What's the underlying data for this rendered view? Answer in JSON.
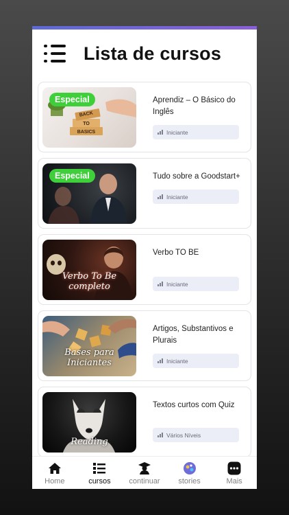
{
  "header": {
    "title": "Lista de cursos"
  },
  "courses": [
    {
      "title": "Aprendiz – O Básico do Inglês",
      "level": "Iniciante",
      "badge": "Especial",
      "thumb_text": "BACK TO BASICS"
    },
    {
      "title": "Tudo sobre a Goodstart+",
      "level": "Iniciante",
      "badge": "Especial",
      "thumb_text": ""
    },
    {
      "title": "Verbo TO BE",
      "level": "Iniciante",
      "badge": "",
      "thumb_text": "Verbo To Be completo"
    },
    {
      "title": "Artigos, Substantivos e Plurais",
      "level": "Iniciante",
      "badge": "",
      "thumb_text": "Bases para Iniciantes"
    },
    {
      "title": "Textos curtos com Quiz",
      "level": "Vários Níveis",
      "badge": "",
      "thumb_text": "Reading"
    }
  ],
  "tabs": [
    {
      "label": "Home",
      "icon": "home-icon"
    },
    {
      "label": "cursos",
      "icon": "course-list-icon",
      "active": true
    },
    {
      "label": "continuar",
      "icon": "graduate-icon"
    },
    {
      "label": "stories",
      "icon": "stories-icon"
    },
    {
      "label": "Mais",
      "icon": "more-icon"
    }
  ],
  "colors": {
    "badge": "#3fcf3a",
    "level_bg": "#eceef7",
    "statusbar": "#6b66d8"
  }
}
